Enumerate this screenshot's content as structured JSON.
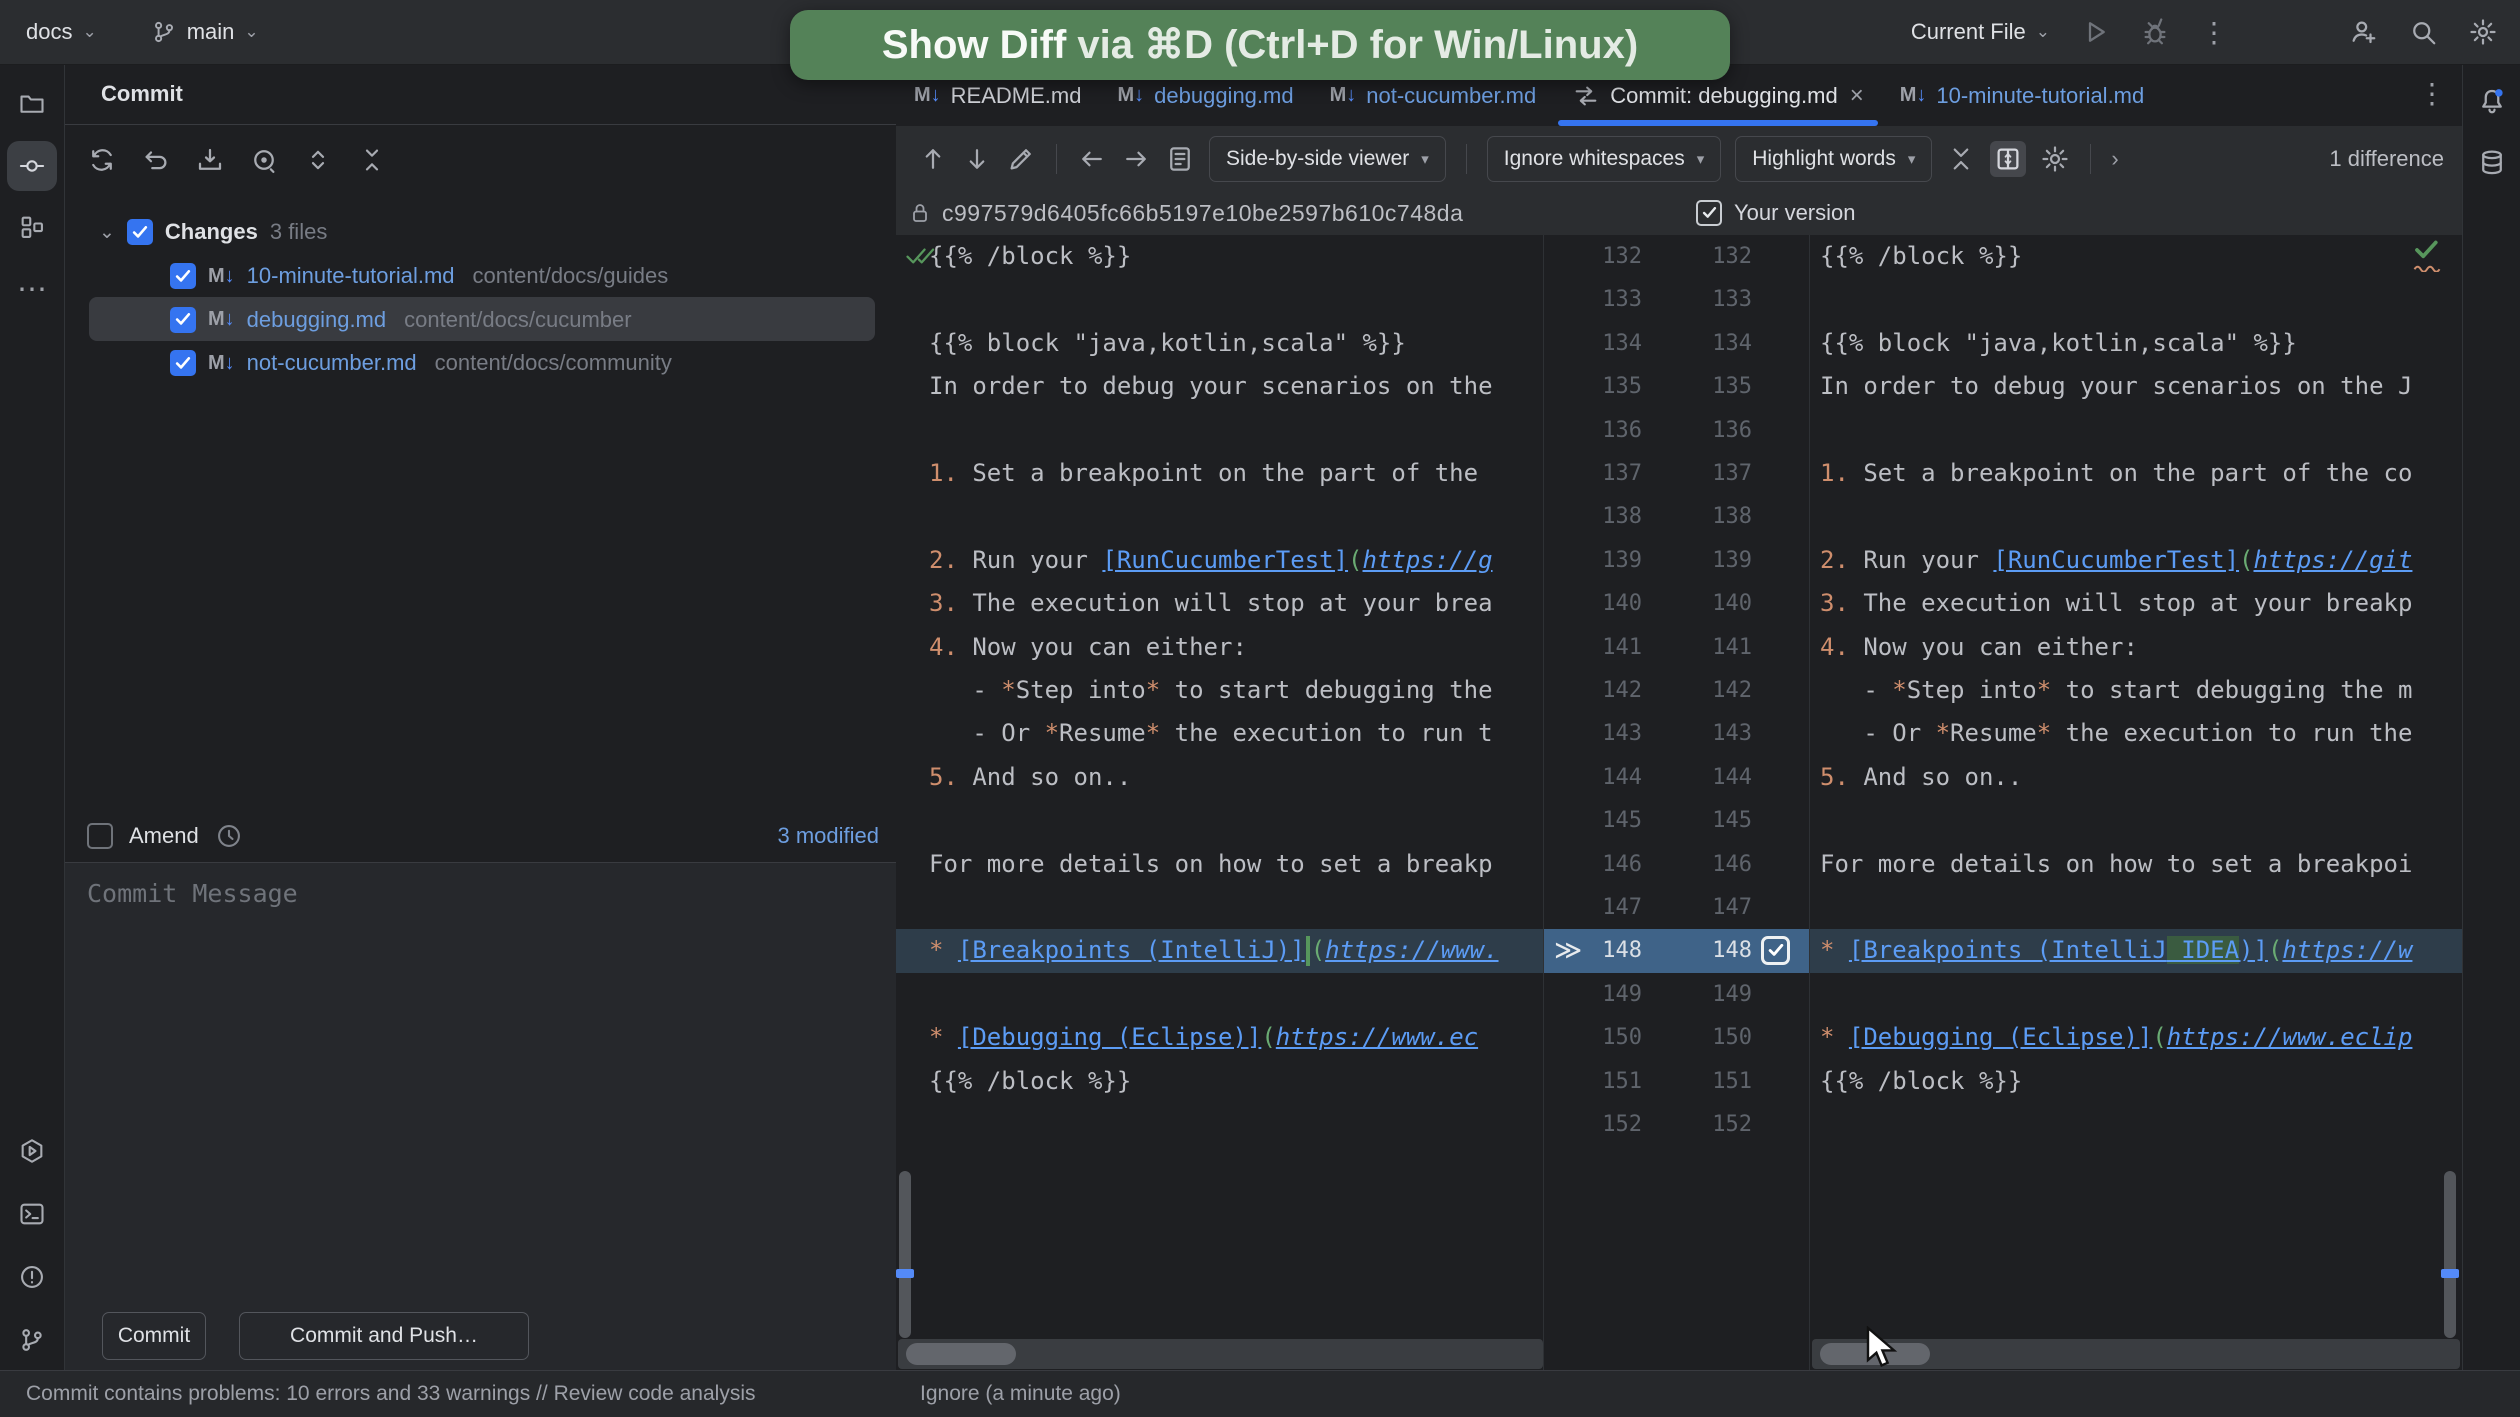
{
  "icons": {
    "chevron_down": "⌄",
    "dropdown_arrow": "▾",
    "kebab": "⋮",
    "more_dots": "⋯",
    "gear": "⚙",
    "chevrons_right": "≫",
    "chevron_right": "›",
    "close": "×",
    "pencil": "✎",
    "play": "▷",
    "arrow_up": "↑",
    "arrow_down": "↓",
    "arrow_left": "←",
    "arrow_right": "→",
    "md_letter": "M",
    "md_arrow": "↓"
  },
  "titlebar": {
    "project": "docs",
    "branch": "main",
    "run_config": "Current File"
  },
  "toast": {
    "highlight": "Show Diff",
    "rest": " via ⌘D (Ctrl+D for Win/Linux)"
  },
  "tabs": [
    {
      "label": "README.md",
      "type": "file",
      "modified": false,
      "active": false,
      "closable": false
    },
    {
      "label": "debugging.md",
      "type": "file",
      "modified": true,
      "active": false,
      "closable": false
    },
    {
      "label": "not-cucumber.md",
      "type": "file",
      "modified": true,
      "active": false,
      "closable": false
    },
    {
      "label": "Commit: debugging.md",
      "type": "diff",
      "modified": false,
      "active": true,
      "closable": true
    },
    {
      "label": "10-minute-tutorial.md",
      "type": "file",
      "modified": true,
      "active": false,
      "closable": false
    }
  ],
  "commit_panel": {
    "title": "Commit",
    "changes_label": "Changes",
    "changes_count": "3 files",
    "files": [
      {
        "name": "10-minute-tutorial.md",
        "path": "content/docs/guides",
        "checked": true,
        "selected": false
      },
      {
        "name": "debugging.md",
        "path": "content/docs/cucumber",
        "checked": true,
        "selected": true
      },
      {
        "name": "not-cucumber.md",
        "path": "content/docs/community",
        "checked": true,
        "selected": false
      }
    ],
    "amend_label": "Amend",
    "modified_label": "3 modified",
    "message_placeholder": "Commit Message",
    "commit_label": "Commit",
    "commit_push_label": "Commit and Push…"
  },
  "diff": {
    "viewer": "Side-by-side viewer",
    "whitespace": "Ignore whitespaces",
    "highlight": "Highlight words",
    "differences": "1 difference",
    "hash": "c997579d6405fc66b5197e10be2597b610c748da",
    "right_title": "Your version"
  },
  "editor": {
    "first_line": 132,
    "lines": [
      {
        "n": 132,
        "chg": false,
        "L": [
          [
            "{{% /block %}}",
            "p"
          ]
        ],
        "R": [
          [
            "{{% /block %}}",
            "p"
          ]
        ]
      },
      {
        "n": 133,
        "chg": false,
        "L": [],
        "R": []
      },
      {
        "n": 134,
        "chg": false,
        "L": [
          [
            "{{% block \"java,kotlin,scala\" %}}",
            "p"
          ]
        ],
        "R": [
          [
            "{{% block \"java,kotlin,scala\" %}}",
            "p"
          ]
        ]
      },
      {
        "n": 135,
        "chg": false,
        "L": [
          [
            "In order to debug your scenarios on the",
            "p"
          ]
        ],
        "R": [
          [
            "In order to debug your scenarios on the J",
            "p"
          ]
        ]
      },
      {
        "n": 136,
        "chg": false,
        "L": [],
        "R": []
      },
      {
        "n": 137,
        "chg": false,
        "L": [
          [
            "1.",
            "o"
          ],
          [
            " Set a breakpoint on the part of the",
            "p"
          ]
        ],
        "R": [
          [
            "1.",
            "o"
          ],
          [
            " Set a breakpoint on the part of the co",
            "p"
          ]
        ]
      },
      {
        "n": 138,
        "chg": false,
        "L": [],
        "R": []
      },
      {
        "n": 139,
        "chg": false,
        "L": [
          [
            "2.",
            "o"
          ],
          [
            " Run your ",
            "p"
          ],
          [
            "[RunCucumberTest]",
            "l"
          ],
          [
            "(",
            "g"
          ],
          [
            "https://g",
            "u"
          ]
        ],
        "R": [
          [
            "2.",
            "o"
          ],
          [
            " Run your ",
            "p"
          ],
          [
            "[RunCucumberTest]",
            "l"
          ],
          [
            "(",
            "g"
          ],
          [
            "https://git",
            "u"
          ]
        ]
      },
      {
        "n": 140,
        "chg": false,
        "L": [
          [
            "3.",
            "o"
          ],
          [
            " The execution will stop at your brea",
            "p"
          ]
        ],
        "R": [
          [
            "3.",
            "o"
          ],
          [
            " The execution will stop at your breakp",
            "p"
          ]
        ]
      },
      {
        "n": 141,
        "chg": false,
        "L": [
          [
            "4.",
            "o"
          ],
          [
            " Now you can either:",
            "p"
          ]
        ],
        "R": [
          [
            "4.",
            "o"
          ],
          [
            " Now you can either:",
            "p"
          ]
        ]
      },
      {
        "n": 142,
        "chg": false,
        "L": [
          [
            "   - ",
            "p"
          ],
          [
            "*",
            "o"
          ],
          [
            "Step into",
            "p"
          ],
          [
            "*",
            "o"
          ],
          [
            " to start debugging the",
            "p"
          ]
        ],
        "R": [
          [
            "   - ",
            "p"
          ],
          [
            "*",
            "o"
          ],
          [
            "Step into",
            "p"
          ],
          [
            "*",
            "o"
          ],
          [
            " to start debugging the m",
            "p"
          ]
        ]
      },
      {
        "n": 143,
        "chg": false,
        "L": [
          [
            "   - Or ",
            "p"
          ],
          [
            "*",
            "o"
          ],
          [
            "Resume",
            "p"
          ],
          [
            "*",
            "o"
          ],
          [
            " the execution to run t",
            "p"
          ]
        ],
        "R": [
          [
            "   - Or ",
            "p"
          ],
          [
            "*",
            "o"
          ],
          [
            "Resume",
            "p"
          ],
          [
            "*",
            "o"
          ],
          [
            " the execution to run the",
            "p"
          ]
        ]
      },
      {
        "n": 144,
        "chg": false,
        "L": [
          [
            "5.",
            "o"
          ],
          [
            " And so on..",
            "p"
          ]
        ],
        "R": [
          [
            "5.",
            "o"
          ],
          [
            " And so on..",
            "p"
          ]
        ]
      },
      {
        "n": 145,
        "chg": false,
        "L": [],
        "R": []
      },
      {
        "n": 146,
        "chg": false,
        "L": [
          [
            "For more details on how to set a breakp",
            "p"
          ]
        ],
        "R": [
          [
            "For more details on how to set a breakpoi",
            "p"
          ]
        ]
      },
      {
        "n": 147,
        "chg": false,
        "L": [],
        "R": []
      },
      {
        "n": 148,
        "chg": true,
        "L": [
          [
            "*",
            "o"
          ],
          [
            " ",
            "p"
          ],
          [
            "[Breakpoints (IntelliJ)]",
            "l"
          ],
          [
            "",
            "m"
          ],
          [
            "(",
            "g"
          ],
          [
            "https://www.",
            "u"
          ]
        ],
        "R": [
          [
            "*",
            "o"
          ],
          [
            " ",
            "p"
          ],
          [
            "[Breakpoints (IntelliJ",
            "l"
          ],
          [
            " IDEA",
            "w"
          ],
          [
            ")]",
            "l"
          ],
          [
            "(",
            "g"
          ],
          [
            "https://w",
            "u"
          ]
        ]
      },
      {
        "n": 149,
        "chg": false,
        "L": [],
        "R": []
      },
      {
        "n": 150,
        "chg": false,
        "L": [
          [
            "*",
            "o"
          ],
          [
            " ",
            "p"
          ],
          [
            "[Debugging (Eclipse)]",
            "l"
          ],
          [
            "(",
            "g"
          ],
          [
            "https://www.ec",
            "u"
          ]
        ],
        "R": [
          [
            "*",
            "o"
          ],
          [
            " ",
            "p"
          ],
          [
            "[Debugging (Eclipse)]",
            "l"
          ],
          [
            "(",
            "g"
          ],
          [
            "https://www.eclip",
            "u"
          ]
        ]
      },
      {
        "n": 151,
        "chg": false,
        "L": [
          [
            "{{% /block %}}",
            "p"
          ]
        ],
        "R": [
          [
            "{{% /block %}}",
            "p"
          ]
        ]
      },
      {
        "n": 152,
        "chg": false,
        "L": [],
        "R": []
      }
    ]
  },
  "statusbar": {
    "message": "Commit contains problems: 10 errors and 33 warnings // Review code analysis",
    "ignore": "Ignore (a minute ago)"
  }
}
